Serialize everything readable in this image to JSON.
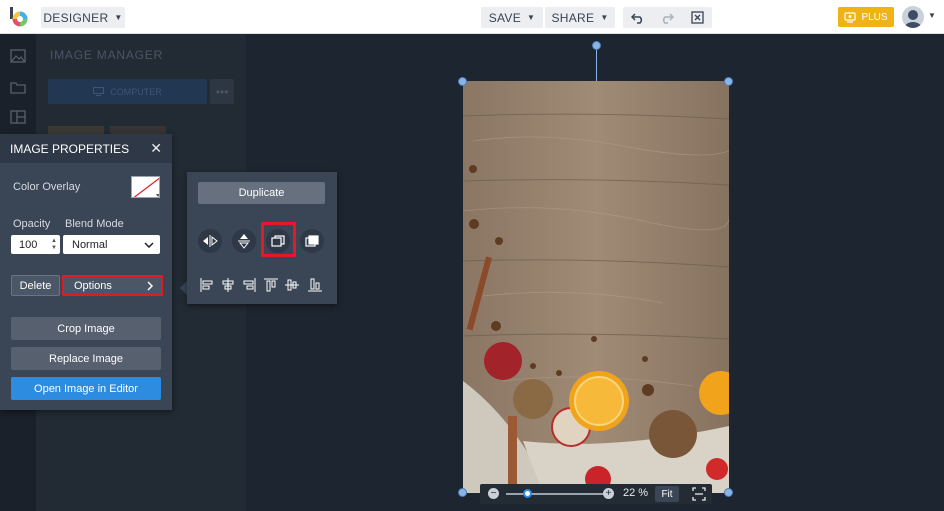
{
  "topbar": {
    "designer_label": "DESIGNER",
    "save_label": "SAVE",
    "share_label": "SHARE",
    "plus_label": "PLUS"
  },
  "side_panel": {
    "title": "IMAGE MANAGER",
    "computer_label": "COMPUTER",
    "more_label": "•••"
  },
  "image_properties": {
    "title": "IMAGE PROPERTIES",
    "color_overlay_label": "Color Overlay",
    "opacity_label": "Opacity",
    "opacity_value": "100",
    "blend_mode_label": "Blend Mode",
    "blend_mode_value": "Normal",
    "delete_label": "Delete",
    "options_label": "Options",
    "crop_label": "Crop Image",
    "replace_label": "Replace Image",
    "open_editor_label": "Open Image in Editor"
  },
  "options_popup": {
    "duplicate_label": "Duplicate"
  },
  "zoom": {
    "value_label": "22 %",
    "fit_label": "Fit",
    "level_percent": 22
  },
  "colors": {
    "accent_blue": "#2d8ce0",
    "highlight_red": "#e01b24",
    "plus_gold": "#f0b315"
  }
}
